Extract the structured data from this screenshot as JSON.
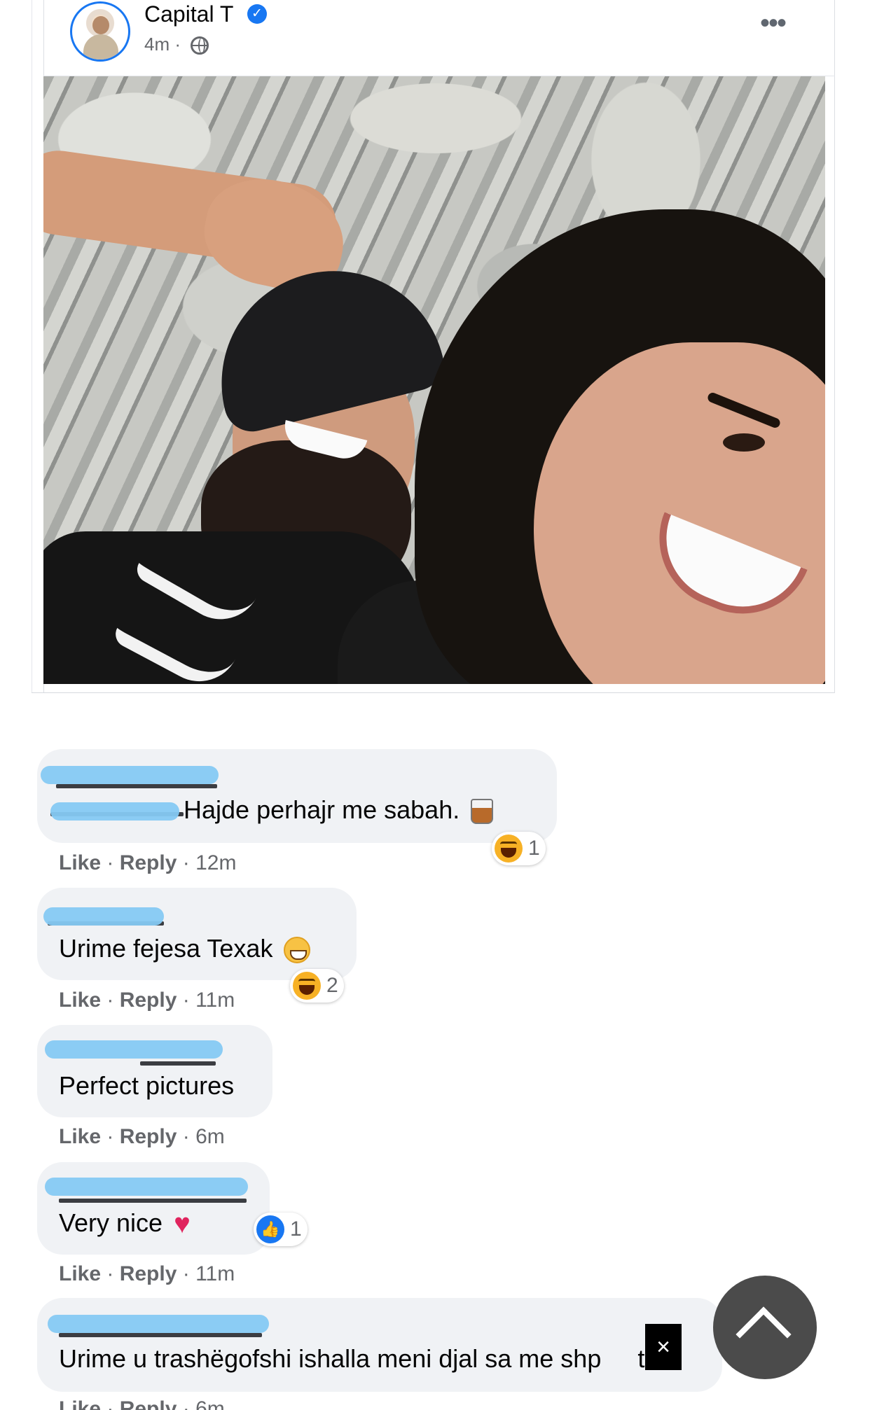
{
  "post": {
    "author": "Capital T",
    "verified_mark": "✓",
    "time": "4m ·",
    "more_label": "•••",
    "photo_description_icon": "photo"
  },
  "comments": [
    {
      "text": "Hajde perhajr me sabah.",
      "emoji": "tumbler-glass-icon",
      "reaction": "haha",
      "reaction_count": "1",
      "like": "Like",
      "sep1": " · ",
      "reply": "Reply",
      "sep2": " · ",
      "time": "12m"
    },
    {
      "text": "Urime fejesa Texak",
      "emoji": "grinning-face-icon",
      "reaction": "haha",
      "reaction_count": "2",
      "like": "Like",
      "sep1": " · ",
      "reply": "Reply",
      "sep2": " · ",
      "time": "11m"
    },
    {
      "text": "Perfect pictures",
      "like": "Like",
      "sep1": " · ",
      "reply": "Reply",
      "sep2": " · ",
      "time": "6m"
    },
    {
      "text": "Very nice",
      "emoji": "heart-icon",
      "reaction": "like",
      "reaction_count": "1",
      "like": "Like",
      "sep1": " · ",
      "reply": "Reply",
      "sep2": " · ",
      "time": "11m"
    },
    {
      "text": "Urime u trashëgofshi ishalla meni djal sa me shp",
      "text_tail": "t"
    }
  ],
  "overlay": {
    "close_label": "×"
  },
  "colors": {
    "accent": "#1877f2",
    "bubble": "#f0f2f5",
    "redaction": "#85c9f3",
    "meta_text": "#65676b"
  }
}
